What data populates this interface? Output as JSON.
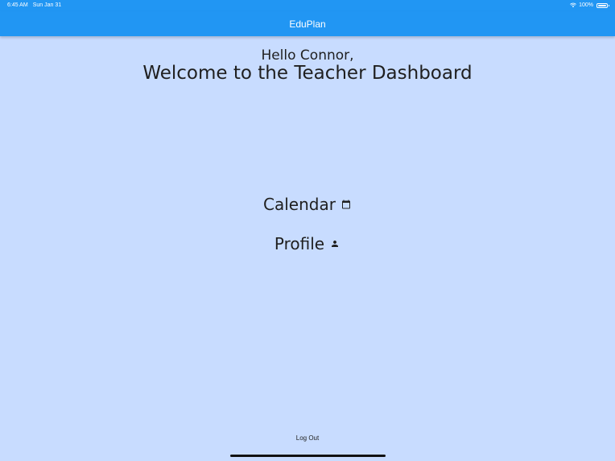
{
  "status_bar": {
    "time": "6:45 AM",
    "date": "Sun Jan 31",
    "battery": "100%"
  },
  "app_bar": {
    "title": "EduPlan"
  },
  "main": {
    "greeting": "Hello Connor,",
    "title": "Welcome to the Teacher Dashboard",
    "links": [
      {
        "label": "Calendar",
        "icon": "calendar-icon"
      },
      {
        "label": "Profile",
        "icon": "person-icon"
      }
    ]
  },
  "footer": {
    "logout_label": "Log Out"
  },
  "colors": {
    "app_bar": "#2196f3",
    "background": "#c8dcff",
    "text": "#1f1f1f"
  }
}
